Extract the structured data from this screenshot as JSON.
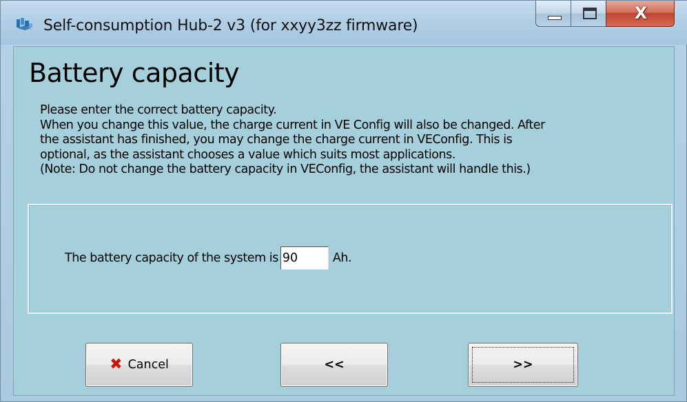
{
  "window": {
    "title": "Self-consumption Hub-2 v3 (for xxyy3zz firmware)",
    "close_glyph": "X"
  },
  "page": {
    "heading": "Battery capacity",
    "description_lines": [
      "Please enter the correct battery capacity.",
      "When you change this value, the charge current in VE Config will also be changed. After",
      "the assistant has finished, you may change the charge current in VEConfig. This is",
      "optional, as the assistant chooses a value which suits most applications.",
      "(Note: Do not change the battery capacity in VEConfig, the assistant will handle this.)"
    ]
  },
  "capacity": {
    "label_before": "The battery capacity of the system is",
    "value": "90",
    "unit": "Ah."
  },
  "buttons": {
    "cancel_icon": "✖",
    "cancel_label": "Cancel",
    "back_label": "<<",
    "next_label": ">>"
  },
  "icons": {
    "app": "app-icon",
    "minimize": "minimize-icon",
    "maximize": "maximize-icon",
    "close": "close-icon",
    "cancel": "cancel-x-icon"
  },
  "colors": {
    "client_bg": "#a6cfdc",
    "close_button": "#c0442f",
    "cancel_icon": "#c8180e"
  }
}
